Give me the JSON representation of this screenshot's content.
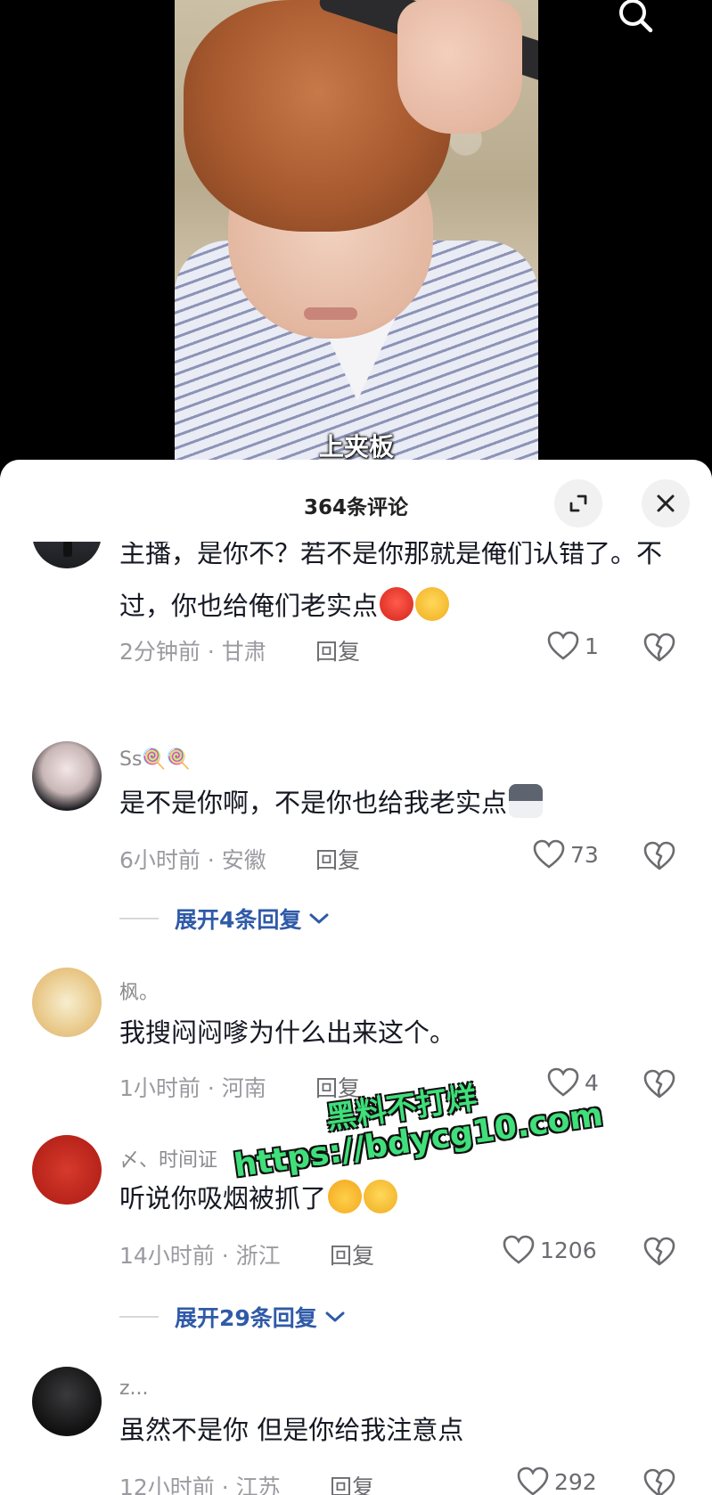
{
  "video": {
    "caption": "上夹板",
    "search_icon": "search-icon"
  },
  "panel": {
    "title": "364条评论",
    "expand_icon": "expand-icon",
    "close_icon": "close-icon"
  },
  "comments": [
    {
      "username": "",
      "text": "主播，是你不？若不是你那就是俺们认错了。不过，你也给俺们老实点",
      "emojis": [
        "angry-emoji",
        "worried-emoji"
      ],
      "time": "2分钟前 · 甘肃",
      "reply_label": "回复",
      "likes": "1"
    },
    {
      "username": "Ss🍭🍭",
      "text": "是不是你啊，不是你也给我老实点",
      "emojis": [
        "husky-emoji"
      ],
      "time": "6小时前 · 安徽",
      "reply_label": "回复",
      "likes": "73",
      "expand_label": "展开4条回复"
    },
    {
      "username": "枫。",
      "text": "我搜闷闷嗲为什么出来这个。",
      "emojis": [],
      "time": "1小时前 · 河南",
      "reply_label": "回复",
      "likes": "4"
    },
    {
      "username": "〆、时间证",
      "text": "听说你吸烟被抓了",
      "emojis": [
        "heart-hands-emoji",
        "thinking-emoji"
      ],
      "time": "14小时前 · 浙江",
      "reply_label": "回复",
      "likes": "1206",
      "expand_label": "展开29条回复"
    },
    {
      "username": "z...",
      "text": "虽然不是你  但是你给我注意点",
      "emojis": [],
      "time": "12小时前 · 江苏",
      "reply_label": "回复",
      "likes": "292"
    }
  ],
  "watermark": {
    "line1": "黑料不打烊",
    "line2": "https://bdycg10.com"
  },
  "colors": {
    "accent_link": "#2f5aa8",
    "watermark_green": "#3fdf7a",
    "text_main": "#161823",
    "text_muted": "#9a9aa0"
  }
}
